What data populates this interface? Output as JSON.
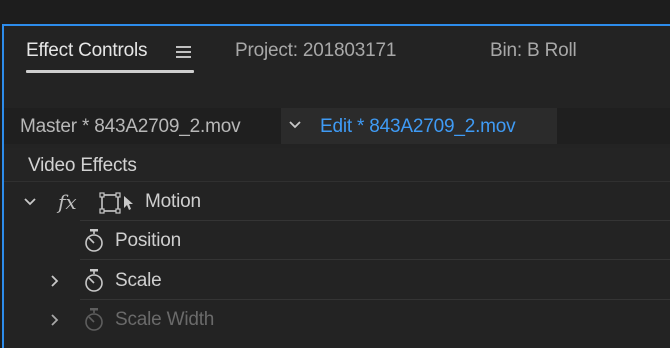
{
  "tabs": {
    "effect_controls": "Effect Controls",
    "project": "Project: 201803171",
    "bin": "Bin: B Roll"
  },
  "clip_bar": {
    "master": "Master * 843A2709_2.mov",
    "edit": "Edit * 843A2709_2.mov"
  },
  "section": {
    "title": "Video Effects"
  },
  "effects": {
    "motion": {
      "fx_label": "fx",
      "label": "Motion",
      "expanded": true
    },
    "properties": [
      {
        "label": "Position",
        "expandable": false,
        "enabled": true
      },
      {
        "label": "Scale",
        "expandable": true,
        "enabled": true
      },
      {
        "label": "Scale Width",
        "expandable": true,
        "enabled": false
      }
    ]
  },
  "colors": {
    "accent": "#2d8ceb",
    "edit_text": "#3f9bf5",
    "panel_bg": "#232323",
    "disabled_text": "#6a6a6a"
  },
  "icons": [
    "menu-icon",
    "chevron-down-icon",
    "fx-icon",
    "motion-transform-icon",
    "stopwatch-icon",
    "chevron-right-icon"
  ]
}
